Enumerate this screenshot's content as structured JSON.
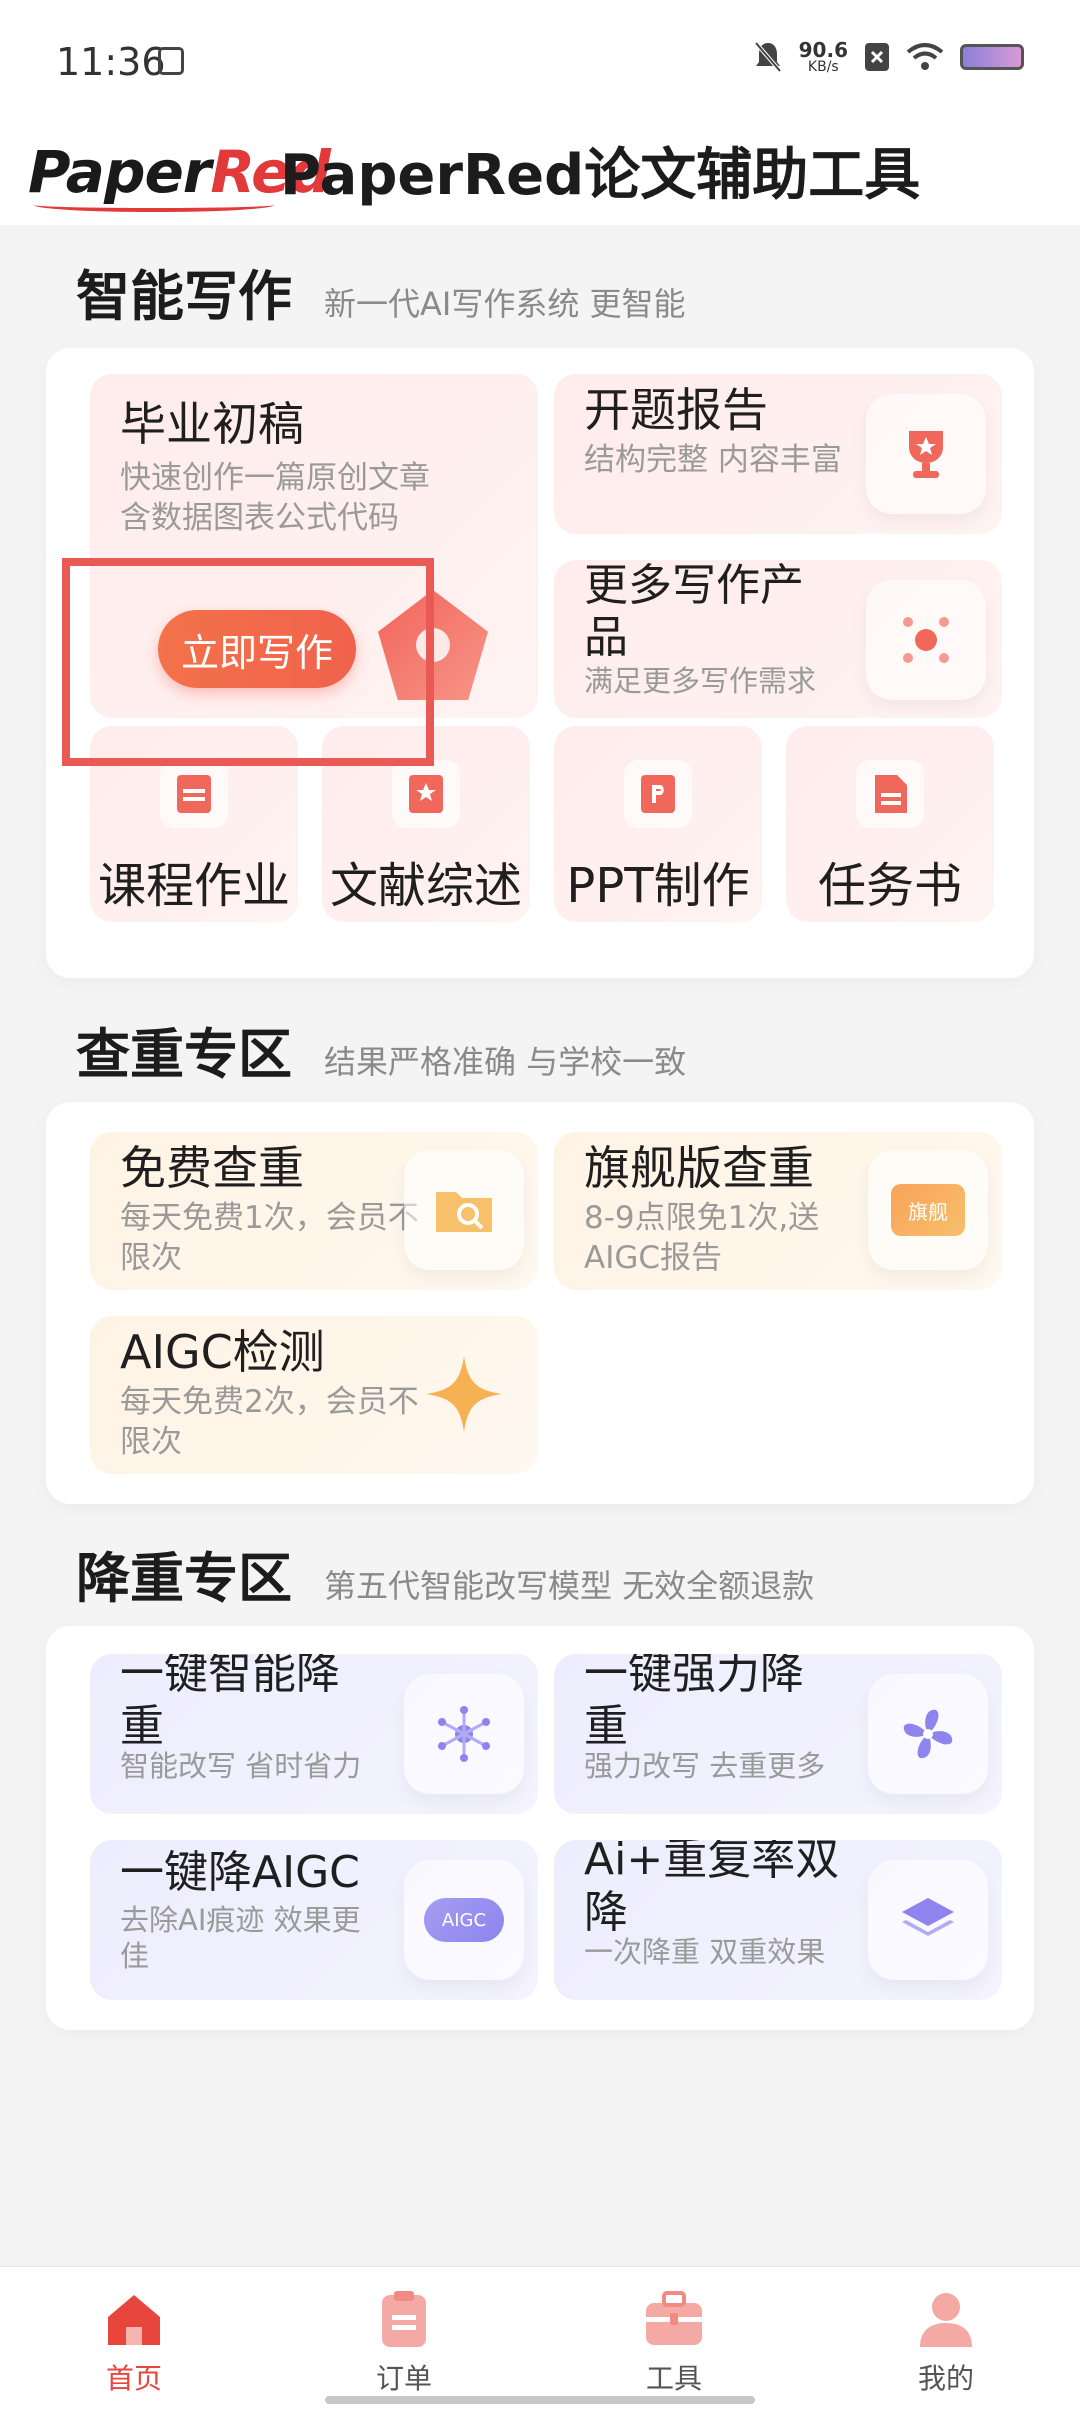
{
  "status": {
    "time": "11:36",
    "net_speed_value": "90.6",
    "net_speed_unit": "KB/s"
  },
  "header": {
    "logo_paper": "Paper",
    "logo_red": "Red",
    "title": "PaperRed论文辅助工具"
  },
  "sections": {
    "writing": {
      "title": "智能写作",
      "subtitle": "新一代AI写作系统 更智能"
    },
    "check": {
      "title": "查重专区",
      "subtitle": "结果严格准确 与学校一致"
    },
    "reduce": {
      "title": "降重专区",
      "subtitle": "第五代智能改写模型 无效全额退款"
    }
  },
  "writing": {
    "draft": {
      "title": "毕业初稿",
      "desc1": "快速创作一篇原创文章",
      "desc2": "含数据图表公式代码",
      "button": "立即写作"
    },
    "proposal": {
      "title": "开题报告",
      "desc": "结构完整 内容丰富"
    },
    "more": {
      "title": "更多写作产品",
      "desc": "满足更多写作需求"
    },
    "small": [
      {
        "label": "课程作业"
      },
      {
        "label": "文献综述"
      },
      {
        "label": "PPT制作"
      },
      {
        "label": "任务书"
      }
    ]
  },
  "check": {
    "free": {
      "title": "免费查重",
      "desc": "每天免费1次，会员不限次"
    },
    "flagship": {
      "title": "旗舰版查重",
      "desc": "8-9点限免1次,送AIGC报告",
      "badge": "旗舰"
    },
    "aigc": {
      "title": "AIGC检测",
      "desc": "每天免费2次，会员不限次"
    }
  },
  "reduce": {
    "smart": {
      "title": "一键智能降重",
      "desc": "智能改写 省时省力"
    },
    "strong": {
      "title": "一键强力降重",
      "desc": "强力改写 去重更多"
    },
    "aigc": {
      "title": "一键降AIGC",
      "desc": "去除AI痕迹 效果更佳",
      "badge": "AIGC"
    },
    "dual": {
      "title": "Ai+重复率双降",
      "desc": "一次降重 双重效果"
    }
  },
  "tabs": [
    {
      "label": "首页",
      "active": true
    },
    {
      "label": "订单"
    },
    {
      "label": "工具"
    },
    {
      "label": "我的"
    }
  ],
  "colors": {
    "accent": "#e8453c",
    "button": "#f0624c",
    "pink_card": "#ffecec",
    "peach_card": "#fff3e4",
    "lavender_card": "#eeedfd"
  }
}
